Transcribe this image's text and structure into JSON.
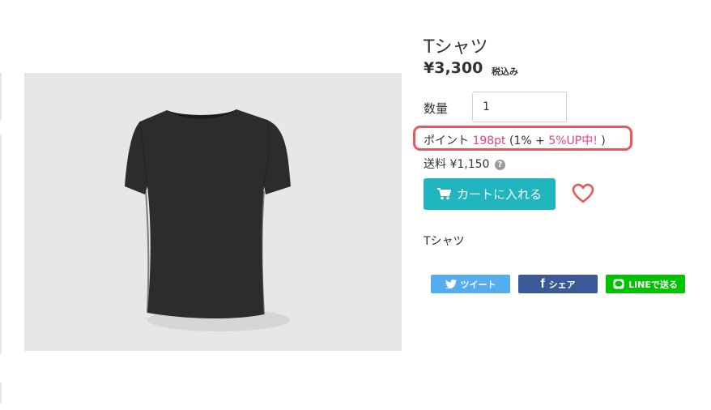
{
  "product": {
    "title": "Tシャツ",
    "price": "¥3,300",
    "tax_note": "税込み",
    "image_icon": "black-tshirt-photo",
    "description": "Tシャツ"
  },
  "quantity": {
    "label": "数量",
    "value": "1"
  },
  "points": {
    "label": "ポイント",
    "amount": "198pt",
    "open": "(1% + ",
    "bonus": "5%UP中!",
    "close": " )"
  },
  "shipping": {
    "label": "送料",
    "value": "¥1,150",
    "help_icon": "question-circle-icon"
  },
  "cart": {
    "label": "カートに入れる",
    "icon": "cart-icon"
  },
  "favorite": {
    "icon": "heart-outline-icon"
  },
  "share": {
    "tweet": "ツイート",
    "facebook": "シェア",
    "line": "LINEで送る"
  },
  "colors": {
    "accent": "#20b5bf",
    "point_pink": "#e8417d",
    "highlight_border": "#e8585a",
    "twitter": "#55acee",
    "facebook": "#3b5998",
    "line": "#00c300"
  }
}
